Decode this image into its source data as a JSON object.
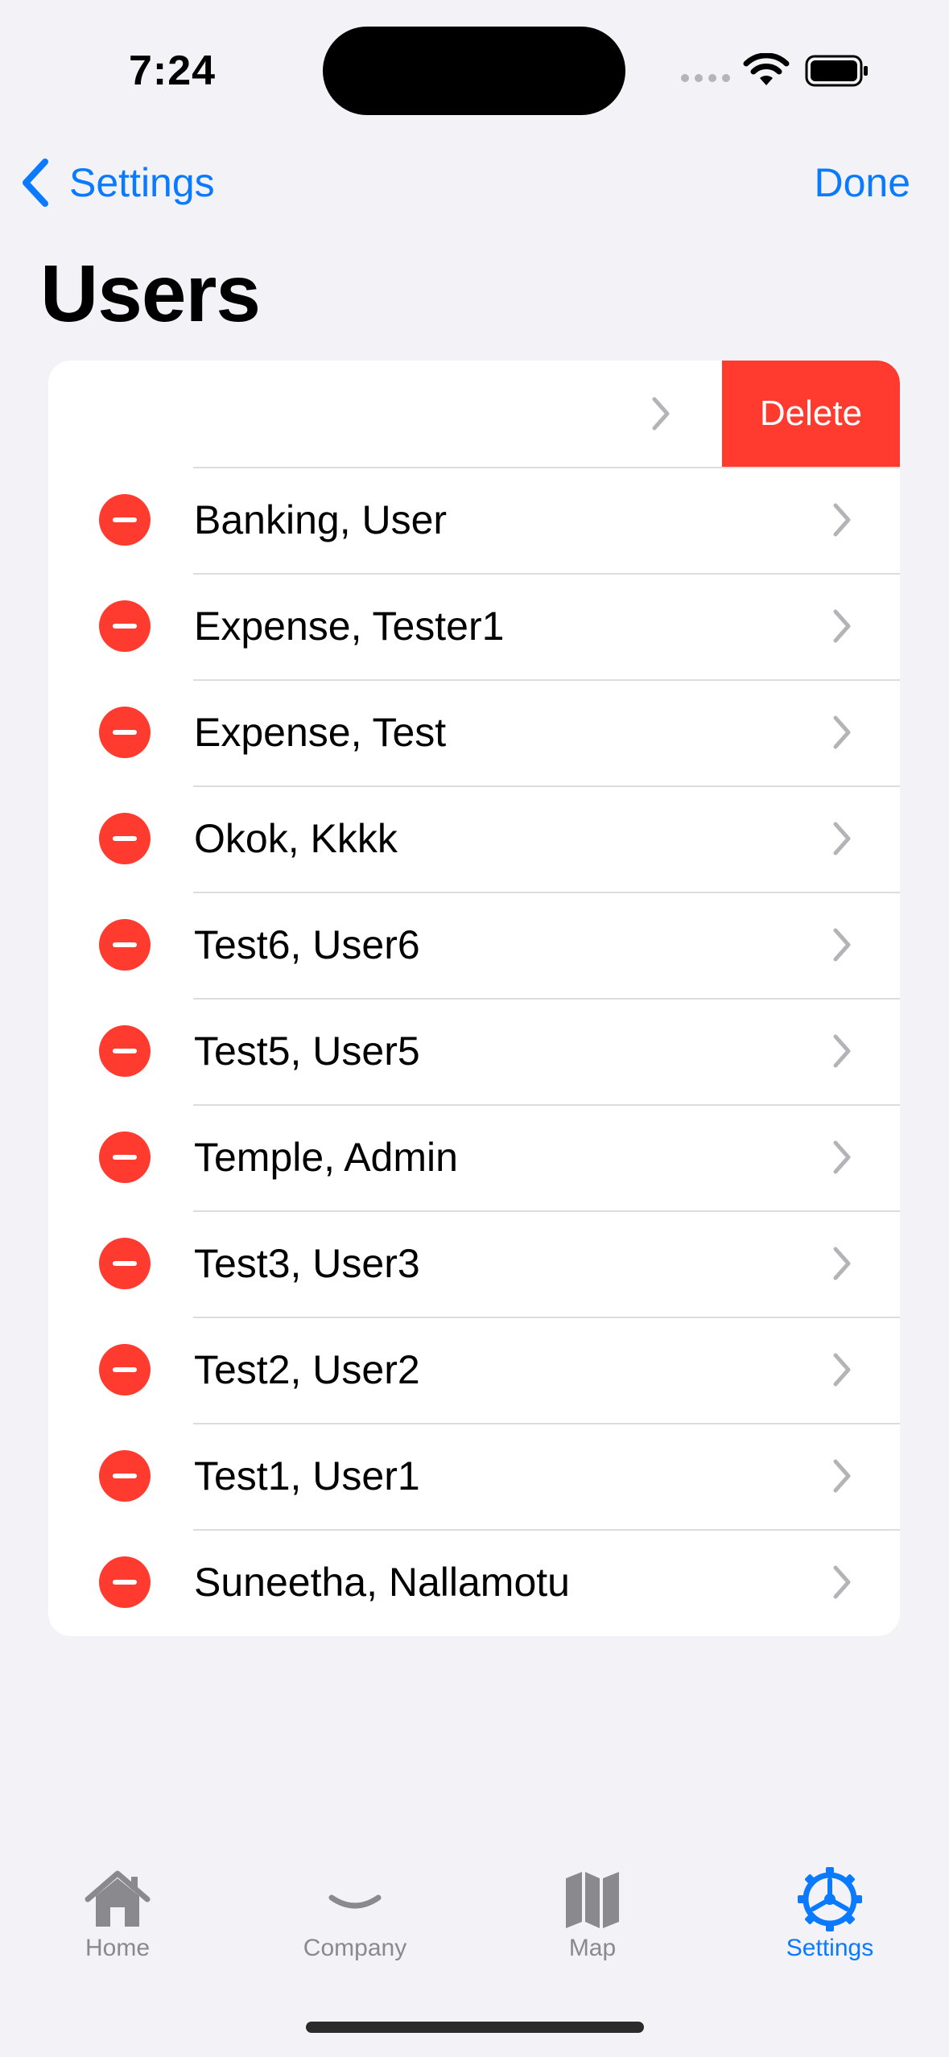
{
  "status_bar": {
    "time": "7:24"
  },
  "nav": {
    "back_label": "Settings",
    "done_label": "Done",
    "title": "Users"
  },
  "swipe_row": {
    "delete_label": "Delete"
  },
  "users": [
    "Banking, User",
    "Expense, Tester1",
    "Expense, Test",
    "Okok, Kkkk",
    "Test6, User6",
    "Test5, User5",
    "Temple, Admin",
    "Test3, User3",
    "Test2, User2",
    "Test1, User1",
    "Suneetha, Nallamotu"
  ],
  "tabs": [
    {
      "label": "Home",
      "icon": "house-icon",
      "active": false
    },
    {
      "label": "Company",
      "icon": "chevron-down-icon",
      "active": false
    },
    {
      "label": "Map",
      "icon": "map-icon",
      "active": false
    },
    {
      "label": "Settings",
      "icon": "gear-icon",
      "active": true
    }
  ],
  "colors": {
    "accent": "#0a7aff",
    "destructive": "#ff3b30",
    "background": "#f2f2f7"
  }
}
